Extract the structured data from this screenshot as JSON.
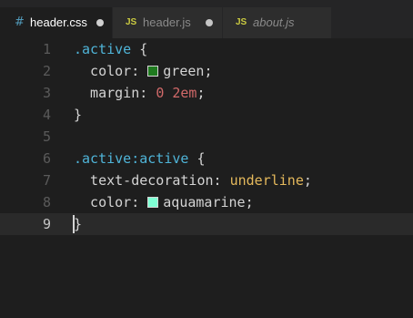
{
  "tabs": [
    {
      "icon": "#",
      "icon_name": "css-file-icon",
      "label": "header.css",
      "state": "active",
      "modified": true
    },
    {
      "icon": "JS",
      "icon_name": "js-file-icon",
      "label": "header.js",
      "state": "inactive",
      "modified": true
    },
    {
      "icon": "JS",
      "icon_name": "js-file-icon",
      "label": "about.js",
      "state": "preview",
      "modified": false
    }
  ],
  "editor": {
    "current_line": 9,
    "lines": [
      {
        "n": "1",
        "tokens": [
          {
            "t": ".active",
            "c": "sel"
          },
          {
            "t": " {",
            "c": "brace"
          }
        ]
      },
      {
        "n": "2",
        "tokens": [
          {
            "t": "  color: ",
            "c": "prop"
          },
          {
            "swatch": "#1f7a1f"
          },
          {
            "t": "green",
            "c": "val-str"
          },
          {
            "t": ";",
            "c": "punc"
          }
        ]
      },
      {
        "n": "3",
        "tokens": [
          {
            "t": "  margin: ",
            "c": "prop"
          },
          {
            "t": "0 2em",
            "c": "num"
          },
          {
            "t": ";",
            "c": "punc"
          }
        ]
      },
      {
        "n": "4",
        "tokens": [
          {
            "t": "}",
            "c": "brace"
          }
        ]
      },
      {
        "n": "5",
        "tokens": []
      },
      {
        "n": "6",
        "tokens": [
          {
            "t": ".active:active",
            "c": "sel"
          },
          {
            "t": " {",
            "c": "brace"
          }
        ]
      },
      {
        "n": "7",
        "tokens": [
          {
            "t": "  text-decoration: ",
            "c": "prop"
          },
          {
            "t": "underline",
            "c": "kw"
          },
          {
            "t": ";",
            "c": "punc"
          }
        ]
      },
      {
        "n": "8",
        "tokens": [
          {
            "t": "  color: ",
            "c": "prop"
          },
          {
            "swatch": "#7fffd4"
          },
          {
            "t": "aquamarine",
            "c": "val-str"
          },
          {
            "t": ";",
            "c": "punc"
          }
        ]
      },
      {
        "n": "9",
        "tokens": [
          {
            "t": "}",
            "c": "brace"
          }
        ]
      }
    ]
  },
  "colors": {
    "background": "#1e1e1e",
    "tabbar": "#252526",
    "selector": "#4fb4d8",
    "number": "#d16969",
    "keyword": "#e5b95c"
  }
}
